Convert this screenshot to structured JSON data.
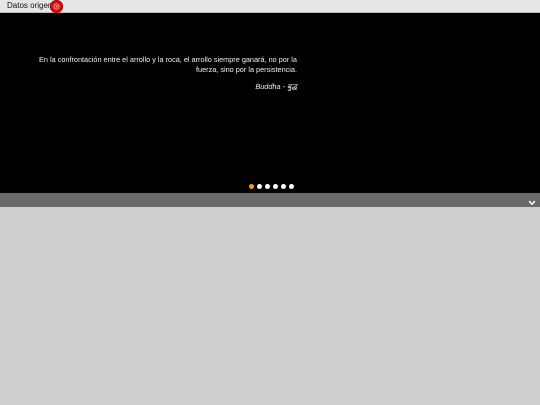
{
  "header": {
    "source_label": "Datos origen",
    "record_icon": "record-icon"
  },
  "slider": {
    "quote": "En la confrontación entre el arrollo y la roca, el arrollo siempre ganará, no por la fuerza, sino por la persistencia.",
    "author": "Buddha - बुद्ध",
    "slide_count": 6,
    "active_slide": 1
  },
  "toolbar": {
    "expand_icon": "chevron-down-icon"
  },
  "colors": {
    "page_background": "#cecece",
    "slider_background": "#000000",
    "active_dot": "#f29a2e",
    "inactive_dot": "#ffffff",
    "toolbar_background": "#6a6a6a",
    "record_button": "#d40f0f"
  }
}
